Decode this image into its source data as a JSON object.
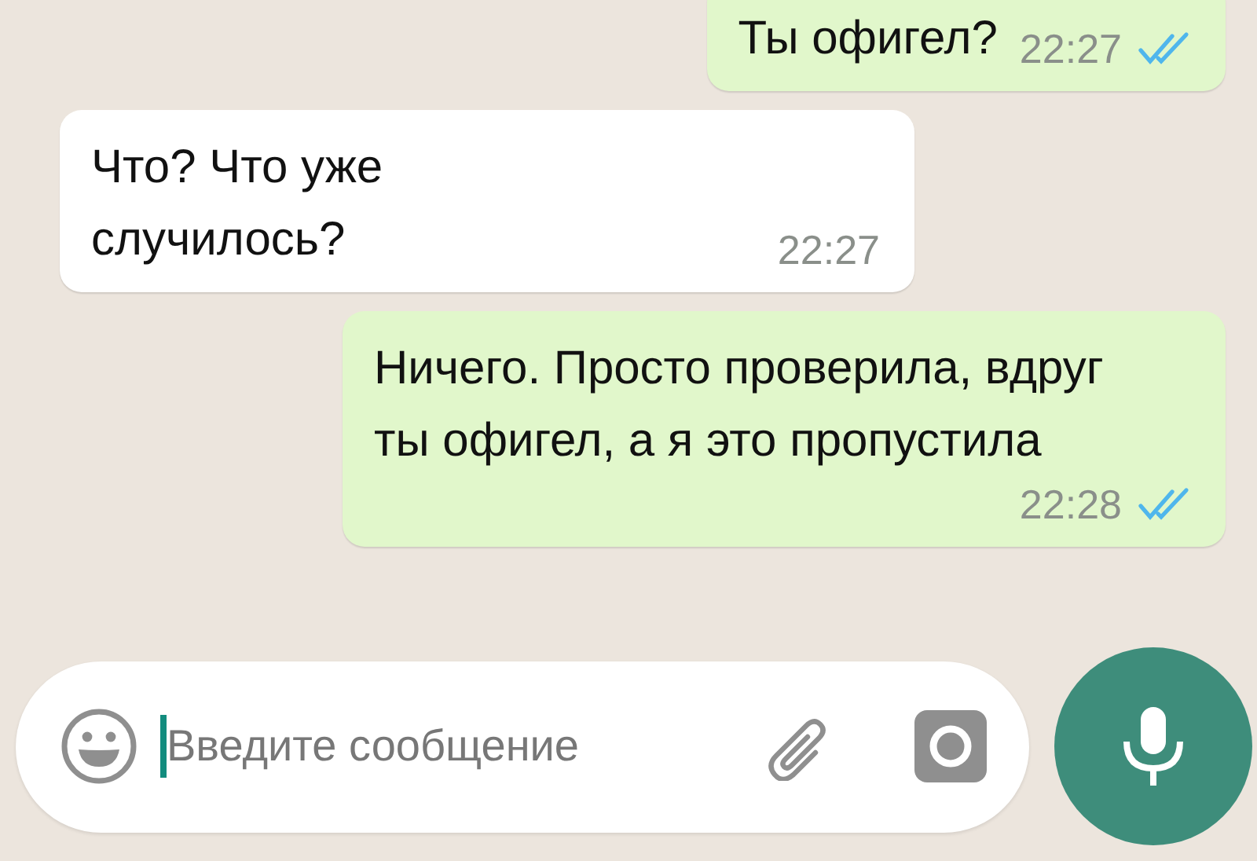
{
  "messages": [
    {
      "kind": "out",
      "text": "Ты офигел?",
      "time": "22:27",
      "read": true
    },
    {
      "kind": "in",
      "text": "Что? Что уже случилось?",
      "time": "22:27"
    },
    {
      "kind": "out",
      "text": "Ничего. Просто проверила, вдруг ты офигел, а я это пропустила",
      "time": "22:28",
      "read": true
    }
  ],
  "composer": {
    "placeholder": "Введите сообщение"
  }
}
